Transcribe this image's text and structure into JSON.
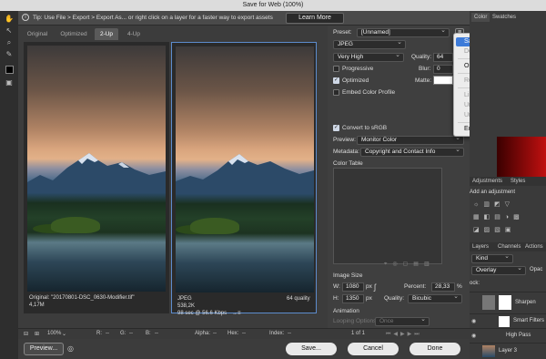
{
  "window": {
    "title": "Save for Web (100%)"
  },
  "tip": {
    "text": "Tip: Use File > Export > Export As... or right click on a layer for a faster way to export assets",
    "learn_more": "Learn More"
  },
  "tabs": [
    {
      "label": "Original",
      "active": false
    },
    {
      "label": "Optimized",
      "active": false
    },
    {
      "label": "2-Up",
      "active": true
    },
    {
      "label": "4-Up",
      "active": false
    }
  ],
  "left_view": {
    "name": "Original: \"20170801-DSC_0630-Modifier.tif\"",
    "size": "4,17M"
  },
  "right_view": {
    "format": "JPEG",
    "size": "538,2K",
    "time": "98 sec @ 56.6 Kbps",
    "quality": "64 quality",
    "menu_symbol": "→≡"
  },
  "settings": {
    "preset_label": "Preset:",
    "preset_value": "[Unnamed]",
    "format": "JPEG",
    "quality_preset": "Very High",
    "quality_label": "Quality:",
    "quality_value": "64",
    "blur_label": "Blur:",
    "blur_value": "0",
    "matte_label": "Matte:",
    "progressive": {
      "label": "Progressive",
      "checked": false
    },
    "optimized": {
      "label": "Optimized",
      "checked": true
    },
    "embed_profile": {
      "label": "Embed Color Profile",
      "checked": false
    },
    "convert_srgb": {
      "label": "Convert to sRGB",
      "checked": true
    },
    "preview_label": "Preview:",
    "preview_value": "Monitor Color",
    "metadata_label": "Metadata:",
    "metadata_value": "Copyright and Contact Info",
    "color_table_label": "Color Table",
    "image_size_label": "Image Size",
    "w_label": "W:",
    "w_value": "1080",
    "h_label": "H:",
    "h_value": "1350",
    "px": "px",
    "percent_label": "Percent:",
    "percent_value": "28,33",
    "percent_unit": "%",
    "quality_resample_label": "Quality:",
    "quality_resample_value": "Bicubic",
    "animation_label": "Animation",
    "looping_label": "Looping Options:",
    "looping_value": "Once",
    "frame_counter": "1 of 1"
  },
  "status": {
    "zoom": "100%",
    "r": "R:",
    "g": "G:",
    "b": "B:",
    "alpha": "Alpha:",
    "hex": "Hex:",
    "index": "Index:",
    "dash": "--"
  },
  "buttons": {
    "preview": "Preview...",
    "save": "Save...",
    "cancel": "Cancel",
    "done": "Done"
  },
  "menu": {
    "items": [
      {
        "label": "Save Settings...",
        "state": "highlighted"
      },
      {
        "label": "Delete Settings",
        "state": "disabled"
      },
      {
        "label": "Optimize to File Size...",
        "state": "enabled"
      },
      {
        "label": "Repopulate Views",
        "state": "disabled"
      },
      {
        "label": "Link Slices",
        "state": "disabled"
      },
      {
        "label": "Unlink Slices",
        "state": "disabled"
      },
      {
        "label": "Unlink All Slices",
        "state": "disabled"
      },
      {
        "label": "Edit Output Settings...",
        "state": "enabled"
      }
    ]
  },
  "right_panel": {
    "tabs_top": [
      "Color",
      "Swatches"
    ],
    "tabs_mid": [
      "Adjustments",
      "Styles"
    ],
    "add_adjustment": "Add an adjustment",
    "tabs_layers": [
      "Layers",
      "Channels",
      "Actions"
    ],
    "kind": "Kind",
    "blend": "Overlay",
    "opacity_short": "Opac",
    "lock_label": "ock:",
    "layers": [
      {
        "name": "Sharpen"
      },
      {
        "name": "Smart Filters"
      },
      {
        "name": "High Pass"
      },
      {
        "name": "Layer 3"
      }
    ]
  },
  "colors": {
    "accent": "#3d7bd9",
    "dialog_bg": "#3f3f3f",
    "highlight_border": "#5d8ccd"
  }
}
